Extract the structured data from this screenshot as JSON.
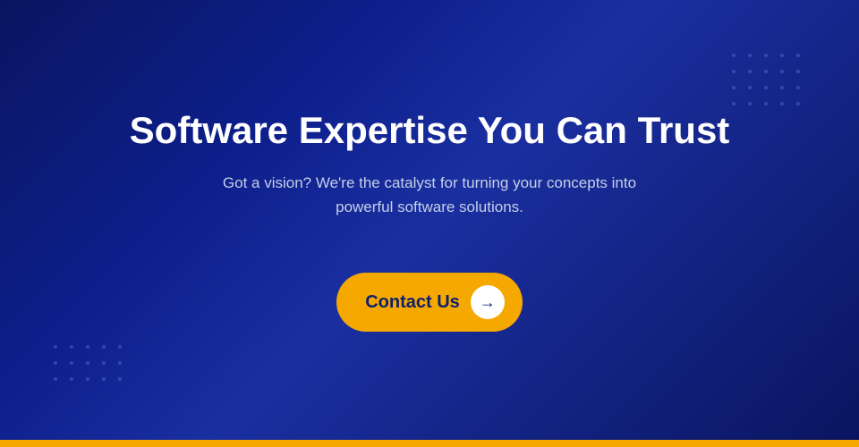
{
  "hero": {
    "title": "Software Expertise You Can Trust",
    "subtitle": "Got a vision? We're the catalyst for turning your concepts into powerful software solutions.",
    "cta_label": "Contact Us",
    "arrow_symbol": "→"
  },
  "colors": {
    "background_start": "#0a1560",
    "background_end": "#1a2fa0",
    "dot_color": "rgba(100, 130, 200, 0.4)",
    "accent": "#f5a800",
    "text_primary": "#ffffff",
    "text_secondary": "#c5cfe8",
    "button_text": "#0d1f6e",
    "bottom_bar": "#f5a800"
  }
}
